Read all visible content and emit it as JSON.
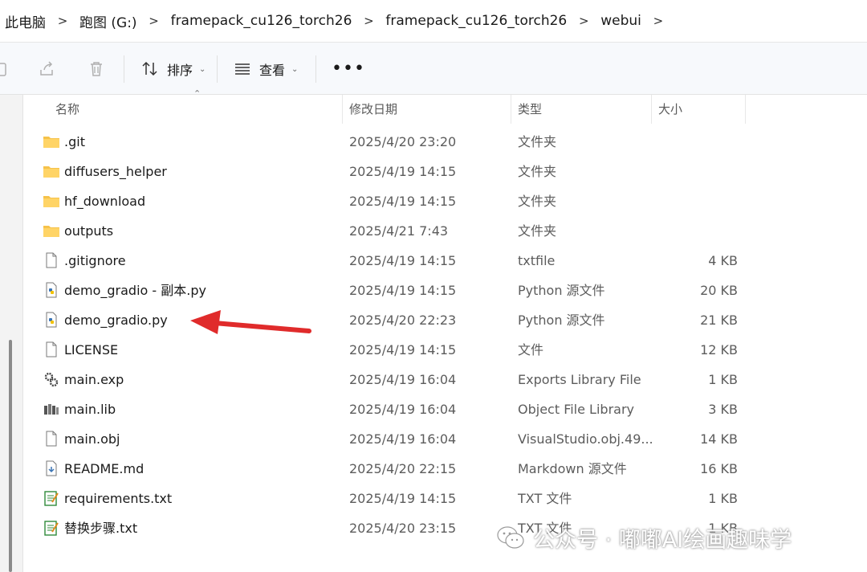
{
  "breadcrumb": {
    "items": [
      "此电脑",
      "跑图 (G:)",
      "framepack_cu126_torch26",
      "framepack_cu126_torch26",
      "webui"
    ],
    "separator": ">"
  },
  "toolbar": {
    "sort_label": "排序",
    "view_label": "查看",
    "more_label": "•••"
  },
  "columns": {
    "name": "名称",
    "date": "修改日期",
    "type": "类型",
    "size": "大小"
  },
  "files": [
    {
      "name": ".git",
      "date": "2025/4/20 23:20",
      "type": "文件夹",
      "size": "",
      "icon": "folder-icon"
    },
    {
      "name": "diffusers_helper",
      "date": "2025/4/19 14:15",
      "type": "文件夹",
      "size": "",
      "icon": "folder-icon"
    },
    {
      "name": "hf_download",
      "date": "2025/4/19 14:15",
      "type": "文件夹",
      "size": "",
      "icon": "folder-icon"
    },
    {
      "name": "outputs",
      "date": "2025/4/21 7:43",
      "type": "文件夹",
      "size": "",
      "icon": "folder-icon"
    },
    {
      "name": ".gitignore",
      "date": "2025/4/19 14:15",
      "type": "txtfile",
      "size": "4 KB",
      "icon": "file-icon"
    },
    {
      "name": "demo_gradio - 副本.py",
      "date": "2025/4/19 14:15",
      "type": "Python 源文件",
      "size": "20 KB",
      "icon": "python-file-icon"
    },
    {
      "name": "demo_gradio.py",
      "date": "2025/4/20 22:23",
      "type": "Python 源文件",
      "size": "21 KB",
      "icon": "python-file-icon"
    },
    {
      "name": "LICENSE",
      "date": "2025/4/19 14:15",
      "type": "文件",
      "size": "12 KB",
      "icon": "file-icon"
    },
    {
      "name": "main.exp",
      "date": "2025/4/19 16:04",
      "type": "Exports Library File",
      "size": "1 KB",
      "icon": "gears-file-icon"
    },
    {
      "name": "main.lib",
      "date": "2025/4/19 16:04",
      "type": "Object File Library",
      "size": "3 KB",
      "icon": "library-file-icon"
    },
    {
      "name": "main.obj",
      "date": "2025/4/19 16:04",
      "type": "VisualStudio.obj.49...",
      "size": "14 KB",
      "icon": "file-icon"
    },
    {
      "name": "README.md",
      "date": "2025/4/20 22:15",
      "type": "Markdown 源文件",
      "size": "16 KB",
      "icon": "markdown-file-icon"
    },
    {
      "name": "requirements.txt",
      "date": "2025/4/19 14:15",
      "type": "TXT 文件",
      "size": "1 KB",
      "icon": "text-file-icon"
    },
    {
      "name": "替换步骤.txt",
      "date": "2025/4/20 23:15",
      "type": "TXT 文件",
      "size": "1 KB",
      "icon": "text-file-icon"
    }
  ],
  "watermark": {
    "text": "公众号 · 嘟嘟AI绘画趣味学"
  },
  "colors": {
    "folder": "#f6c24a",
    "arrow": "#e02b2b",
    "accent": "#0067c0"
  }
}
